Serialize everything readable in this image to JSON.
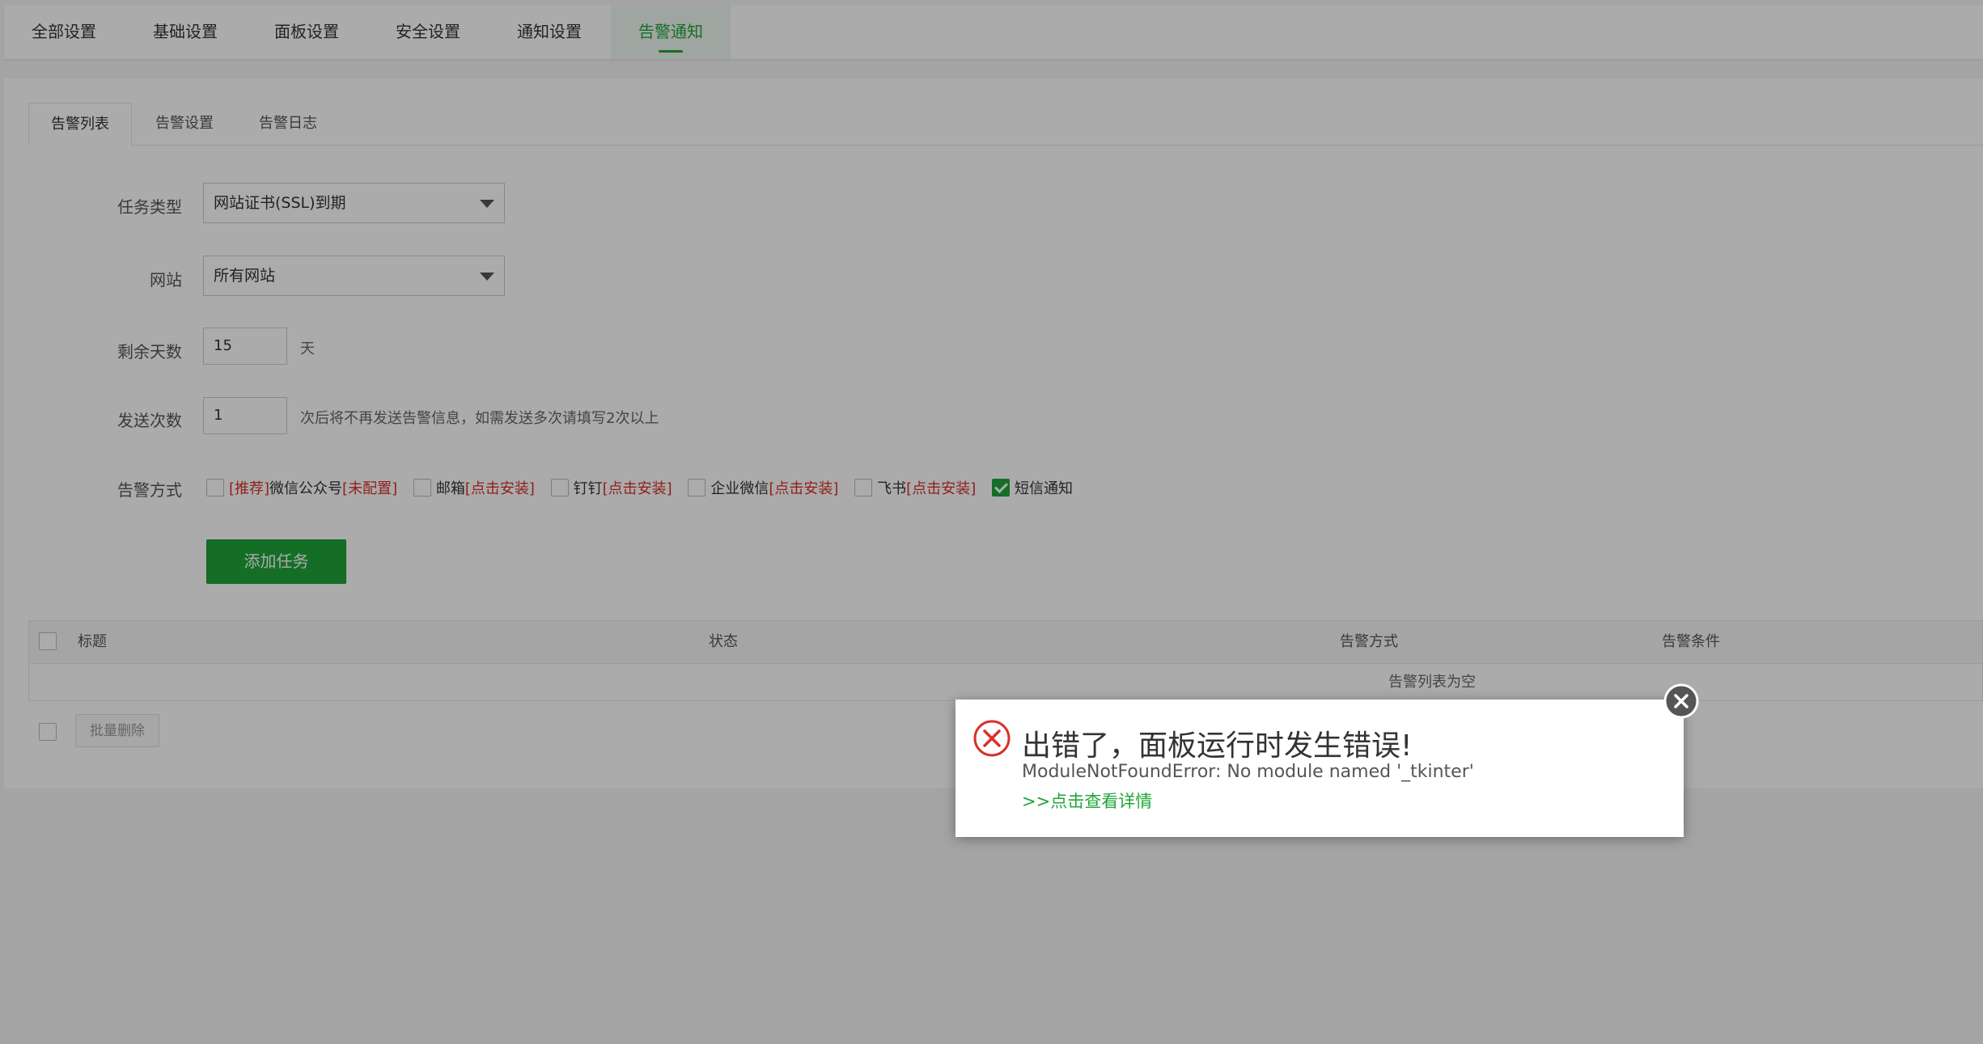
{
  "top_tabs": [
    "全部设置",
    "基础设置",
    "面板设置",
    "安全设置",
    "通知设置",
    "告警通知"
  ],
  "top_active": "告警通知",
  "sub_tabs": [
    "告警列表",
    "告警设置",
    "告警日志"
  ],
  "form": {
    "task_type_label": "任务类型",
    "task_type_value": "网站证书(SSL)到期",
    "site_label": "网站",
    "site_value": "所有网站",
    "days_label": "剩余天数",
    "days_value": "15",
    "days_unit": "天",
    "count_label": "发送次数",
    "count_value": "1",
    "count_hint": "次后将不再发送告警信息，如需发送多次请填写2次以上",
    "method_label": "告警方式",
    "methods": [
      {
        "prefix": "[推荐]",
        "name": "微信公众号",
        "suffix": "[未配置]",
        "checked": false
      },
      {
        "prefix": "",
        "name": "邮箱",
        "suffix": "[点击安装]",
        "checked": false
      },
      {
        "prefix": "",
        "name": "钉钉",
        "suffix": "[点击安装]",
        "checked": false
      },
      {
        "prefix": "",
        "name": "企业微信",
        "suffix": "[点击安装]",
        "checked": false
      },
      {
        "prefix": "",
        "name": "飞书",
        "suffix": "[点击安装]",
        "checked": false
      },
      {
        "prefix": "",
        "name": "短信通知",
        "suffix": "",
        "checked": true
      }
    ],
    "add_button": "添加任务"
  },
  "table": {
    "headers": [
      "标题",
      "状态",
      "告警方式",
      "告警条件"
    ],
    "empty_text": "告警列表为空",
    "batch_delete": "批量删除"
  },
  "dialog": {
    "title": "出错了，面板运行时发生错误!",
    "message": "ModuleNotFoundError: No module named '_tkinter'",
    "link": ">>点击查看详情"
  },
  "colors": {
    "accent": "#20a53a",
    "error": "#d9302a"
  }
}
